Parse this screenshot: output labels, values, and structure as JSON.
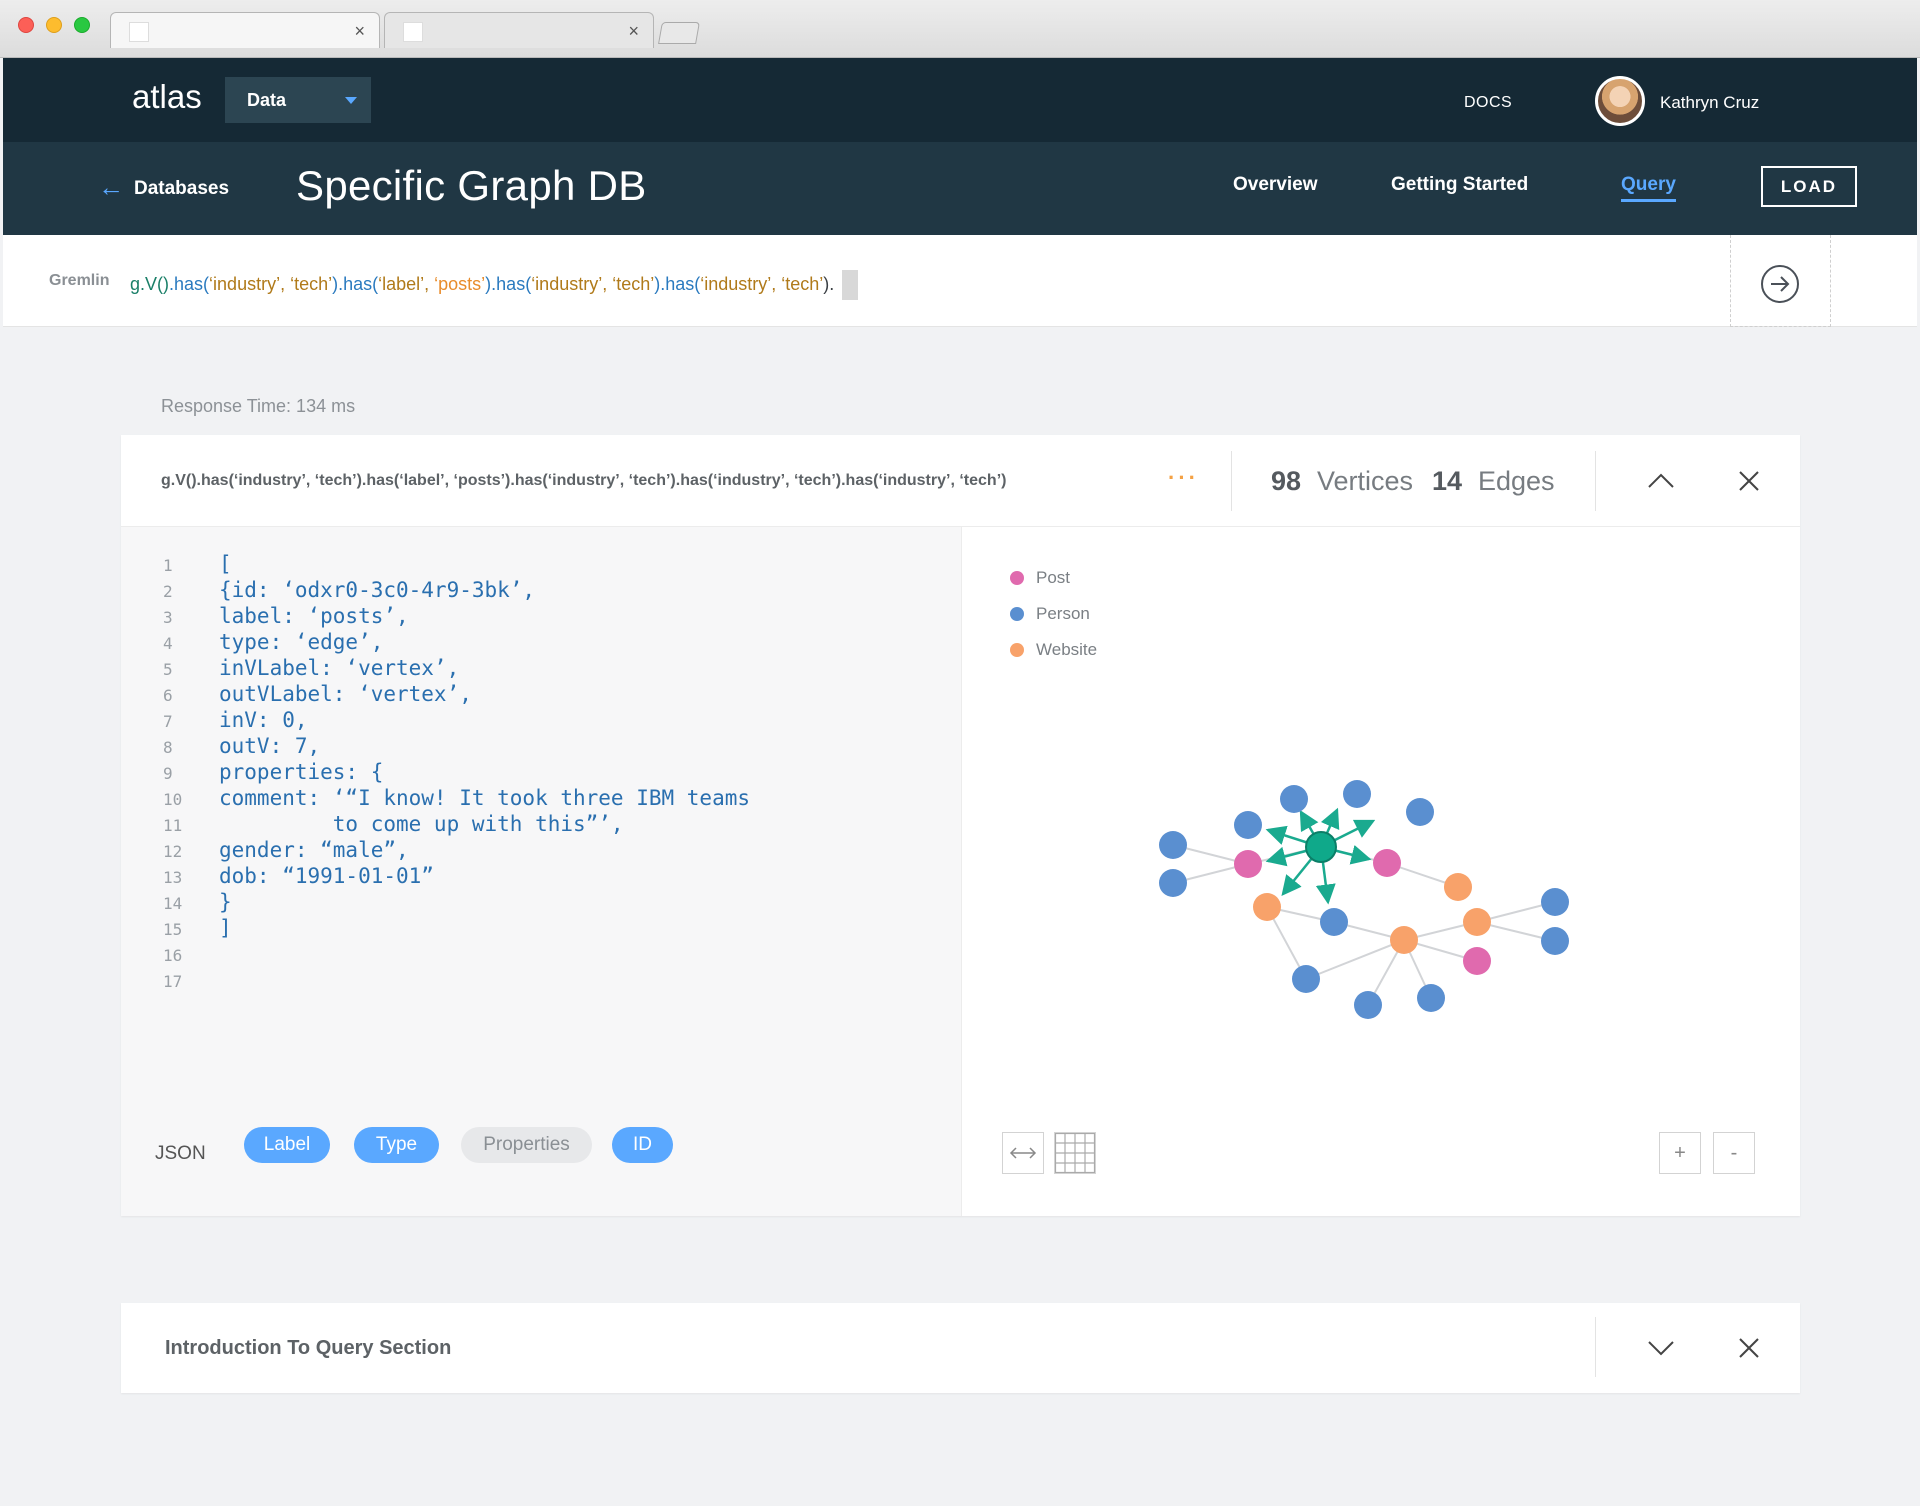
{
  "app": {
    "logo": "atlas",
    "dropdown_selected": "Data",
    "docs_link": "DOCS",
    "user_name": "Kathryn Cruz"
  },
  "subnav": {
    "back_label": "Databases",
    "title": "Specific Graph DB",
    "tabs": [
      {
        "label": "Overview",
        "active": false
      },
      {
        "label": "Getting Started",
        "active": false
      },
      {
        "label": "Query",
        "active": true
      }
    ],
    "load_button": "LOAD"
  },
  "query": {
    "language": "Gremlin",
    "tokens": [
      {
        "t": "g.V()",
        "c": "c-green"
      },
      {
        "t": ".has(",
        "c": "c-blue"
      },
      {
        "t": "‘industry’, ‘tech’",
        "c": "c-gold"
      },
      {
        "t": ").has(",
        "c": "c-blue"
      },
      {
        "t": "‘label’, ",
        "c": "c-gold"
      },
      {
        "t": "‘posts’",
        "c": "c-orange"
      },
      {
        "t": ").has(",
        "c": "c-blue"
      },
      {
        "t": "‘industry’, ‘tech’",
        "c": "c-gold"
      },
      {
        "t": ").has(",
        "c": "c-blue"
      },
      {
        "t": "‘industry’, ‘tech’",
        "c": "c-gold"
      },
      {
        "t": ").",
        "c": "c-dark"
      }
    ]
  },
  "response_time": "Response Time: 134 ms",
  "result": {
    "query": "g.V().has(‘industry’, ‘tech’).has(‘label’, ‘posts’).has(‘industry’, ‘tech’).has(‘industry’, ‘tech’).has(‘industry’, ‘tech’)",
    "more": "···",
    "vertices_count": "98",
    "vertices_label": "Vertices",
    "edges_count": "14",
    "edges_label": "Edges",
    "code_lines": [
      "[",
      "{id: ‘odxr0-3c0-4r9-3bk’,",
      "label: ‘posts’,",
      "type: ‘edge’,",
      "inVLabel: ‘vertex’,",
      "outVLabel: ‘vertex’,",
      "inV: 0,",
      "outV: 7,",
      "properties: {",
      "comment: ‘“I know! It took three IBM teams",
      "         to come up with this”’,",
      "gender: “male”,",
      "dob: “1991-01-01”",
      "}",
      "]",
      "",
      ""
    ],
    "format_label": "JSON",
    "pills": [
      {
        "label": "Label",
        "active": true
      },
      {
        "label": "Type",
        "active": true
      },
      {
        "label": "Properties",
        "active": false
      },
      {
        "label": "ID",
        "active": true
      }
    ],
    "legend": [
      {
        "label": "Post",
        "color": "#e06aae"
      },
      {
        "label": "Person",
        "color": "#5a8fd0"
      },
      {
        "label": "Website",
        "color": "#f8a26a"
      }
    ],
    "zoom_in": "+",
    "zoom_out": "-"
  },
  "intro": {
    "title": "Introduction To Query Section"
  }
}
